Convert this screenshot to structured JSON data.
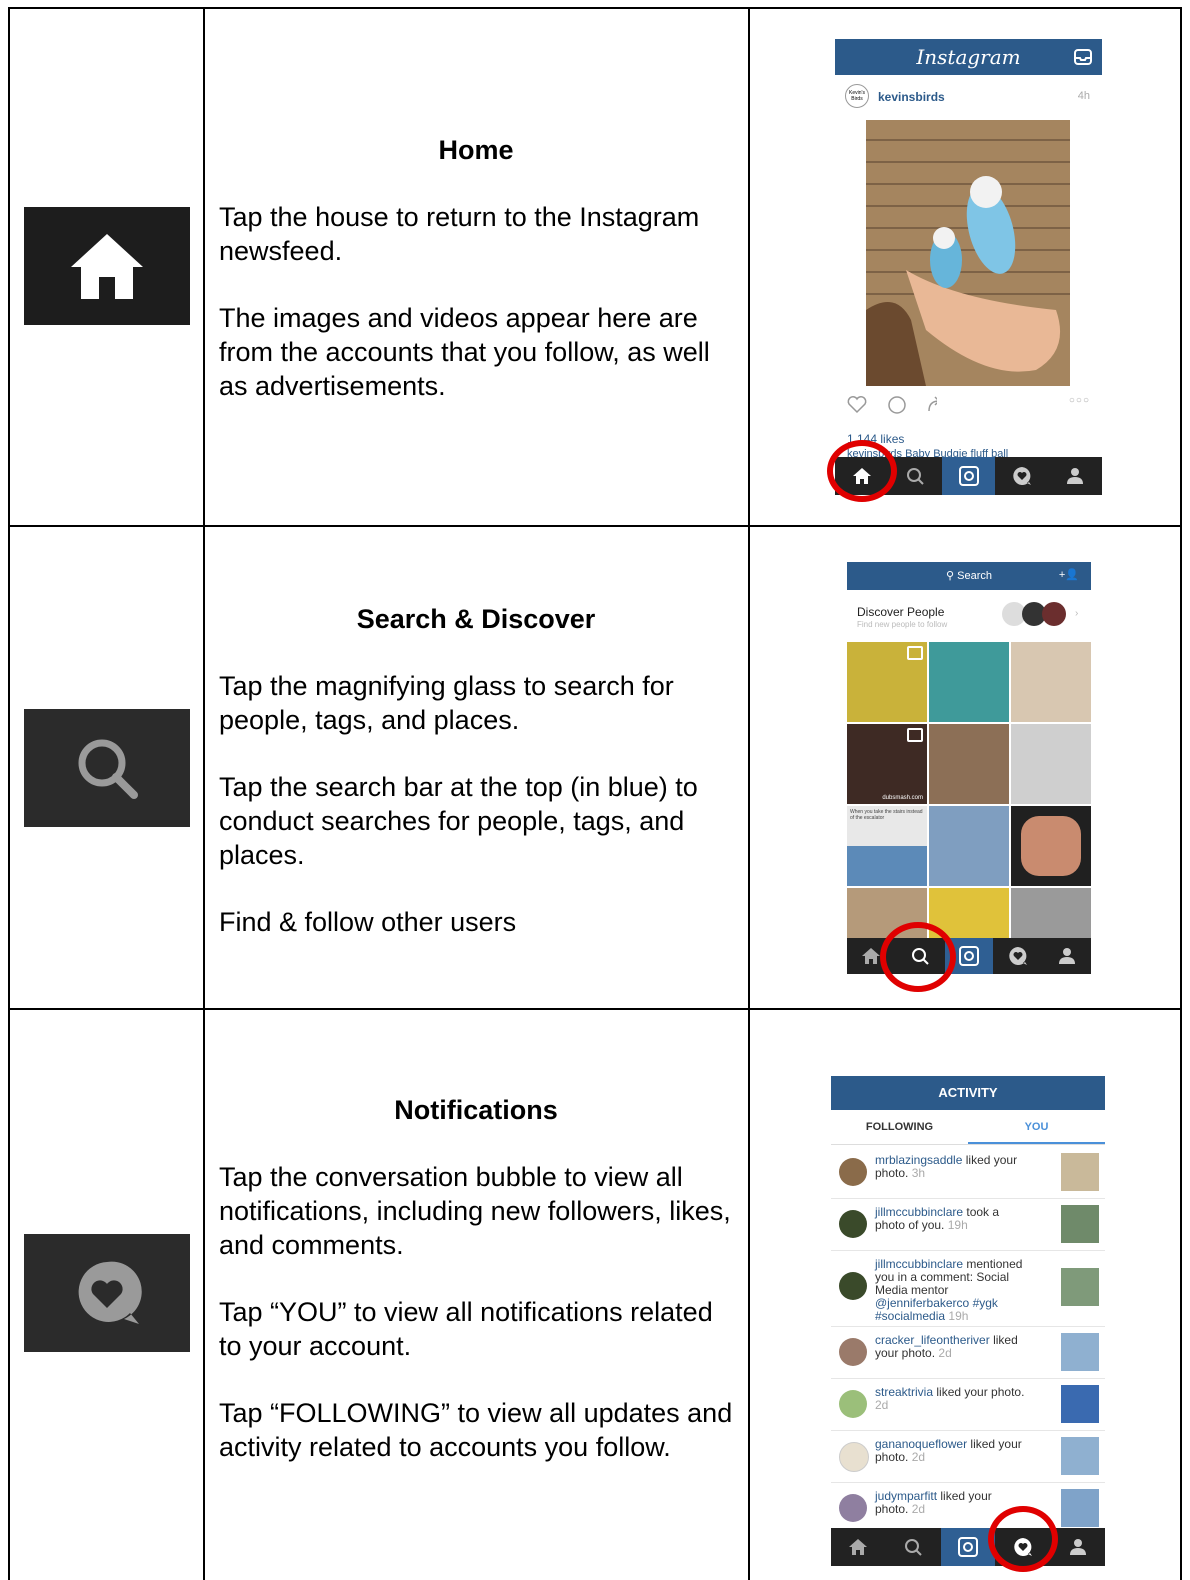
{
  "rows": [
    {
      "heading": "Home",
      "paragraphs": [
        "Tap the house to return to the Instagram newsfeed.",
        "The images and videos appear here are from the accounts that you follow, as well as advertisements."
      ],
      "icon": "home-icon"
    },
    {
      "heading": "Search & Discover",
      "paragraphs": [
        "Tap the magnifying glass to search for people, tags, and places.",
        "Tap the search bar at the top (in blue) to conduct searches for people, tags, and places.",
        "Find & follow other users"
      ],
      "icon": "search-icon"
    },
    {
      "heading": "Notifications",
      "paragraphs": [
        "Tap the conversation bubble to view all notifications, including new followers, likes, and comments.",
        "Tap “YOU” to view all notifications related to your account.",
        "Tap “FOLLOWING” to view all updates and activity related to accounts you follow."
      ],
      "icon": "heart-bubble-icon"
    }
  ],
  "home_shot": {
    "app_title": "Instagram",
    "username": "kevinsbirds",
    "avatar_text": "Kevin's Birds",
    "time": "4h",
    "likes": "1,144 likes",
    "caption_partial": "kevinsbirds Baby Budgie fluff ball"
  },
  "search_shot": {
    "search_placeholder": "Search",
    "discover_title": "Discover People",
    "discover_sub": "Find new people to follow",
    "tile_caption_dubsmash": "dubsmash.com",
    "tile_caption_stairs": "When you take the stairs instead of the escalator"
  },
  "activity_shot": {
    "title": "ACTIVITY",
    "tab_following": "FOLLOWING",
    "tab_you": "YOU",
    "items": [
      {
        "user": "mrblazingsaddle",
        "text": "liked your photo.",
        "time": "3h"
      },
      {
        "user": "jillmccubbinclare",
        "text": "took a photo of you.",
        "time": "19h"
      },
      {
        "user": "jillmccubbinclare",
        "text": "mentioned you in a comment: Social Media mentor",
        "extra": "@jenniferbakerco #ygk #socialmedia",
        "time": "19h"
      },
      {
        "user": "cracker_lifeontheriver",
        "text": "liked your photo.",
        "time": "2d"
      },
      {
        "user": "streaktrivia",
        "text": "liked your photo.",
        "time": "2d"
      },
      {
        "user": "gananoqueflower",
        "text": "liked your photo.",
        "time": "2d"
      },
      {
        "user": "judymparfitt",
        "text": "liked your photo.",
        "time": "2d"
      }
    ]
  },
  "colors": {
    "ig_blue": "#2c5a8a",
    "highlight_red": "#e00000",
    "navbar": "#222222"
  }
}
